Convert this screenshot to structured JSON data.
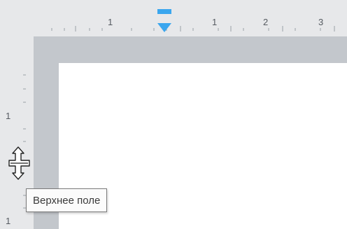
{
  "window": {
    "background": "#e7e8ea"
  },
  "horizontal_ruler": {
    "labels": [
      "1",
      "1",
      "2",
      "3"
    ],
    "indent_marker_color": "#3aa6ee"
  },
  "vertical_ruler": {
    "labels": [
      "1",
      "1"
    ]
  },
  "document": {
    "frame_color": "#c3c7cc",
    "page_color": "#ffffff"
  },
  "cursor": {
    "icon": "resize-vertical-cursor-icon"
  },
  "tooltip": {
    "text": "Верхнее поле"
  }
}
